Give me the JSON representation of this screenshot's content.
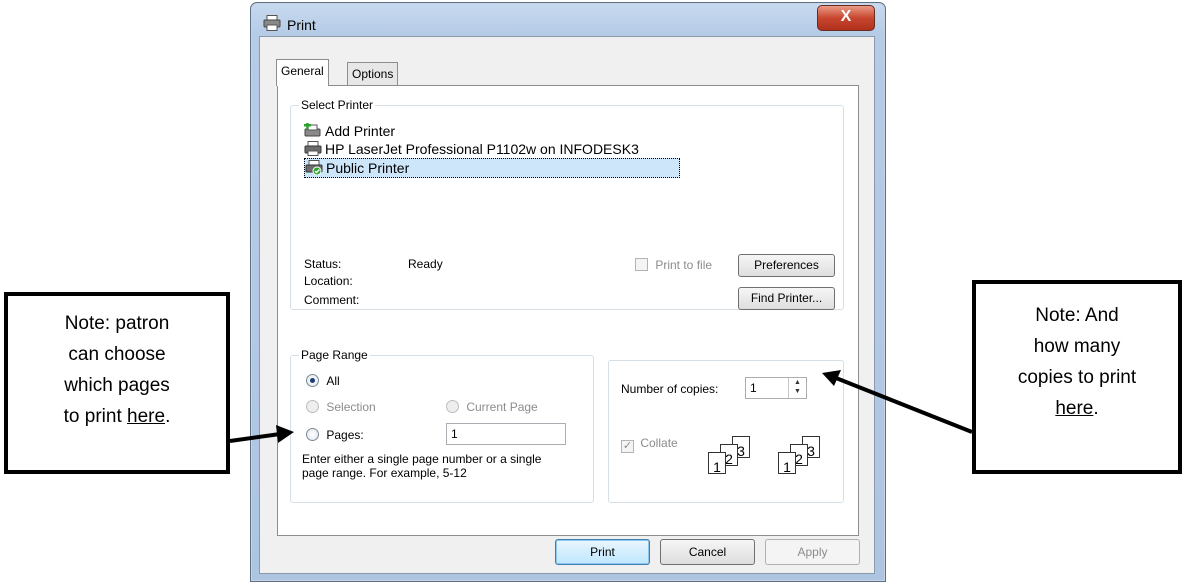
{
  "window": {
    "title": "Print",
    "close_symbol": "X"
  },
  "tabs": [
    {
      "label": "General",
      "active": true
    },
    {
      "label": "Options",
      "active": false
    }
  ],
  "select_printer": {
    "legend": "Select Printer",
    "printers": [
      {
        "label": "Add Printer",
        "icon": "add-printer-icon"
      },
      {
        "label": "HP LaserJet Professional P1102w on INFODESK3",
        "icon": "printer-icon"
      },
      {
        "label": "Public Printer",
        "icon": "default-printer-icon",
        "selected": true
      }
    ],
    "status_label": "Status:",
    "status_value": "Ready",
    "location_label": "Location:",
    "comment_label": "Comment:",
    "print_to_file_label": "Print to file",
    "preferences_button": "Preferences",
    "find_printer_button": "Find Printer..."
  },
  "page_range": {
    "legend": "Page Range",
    "all_label": "All",
    "selection_label": "Selection",
    "current_page_label": "Current Page",
    "pages_label": "Pages:",
    "pages_value": "1",
    "hint_line1": "Enter either a single page number or a single",
    "hint_line2": "page range.  For example, 5-12"
  },
  "copies": {
    "number_label": "Number of copies:",
    "number_value": "1",
    "collate_label": "Collate",
    "collate_pages": [
      "1",
      "2",
      "3"
    ]
  },
  "footer": {
    "print_button": "Print",
    "cancel_button": "Cancel",
    "apply_button": "Apply"
  },
  "notes": {
    "left": {
      "line1": "Note: patron",
      "line2": "can choose",
      "line3": "which pages",
      "line4_prefix": "to print ",
      "line4_link": "here",
      "line4_suffix": "."
    },
    "right": {
      "line1": "Note: And",
      "line2": "how many",
      "line3": "copies to print",
      "line4_link": "here",
      "line4_suffix": "."
    }
  },
  "colors": {
    "selected_bg": "#cde6fa",
    "default_button_border": "#3c7fb1",
    "close_red": "#c8462f"
  }
}
